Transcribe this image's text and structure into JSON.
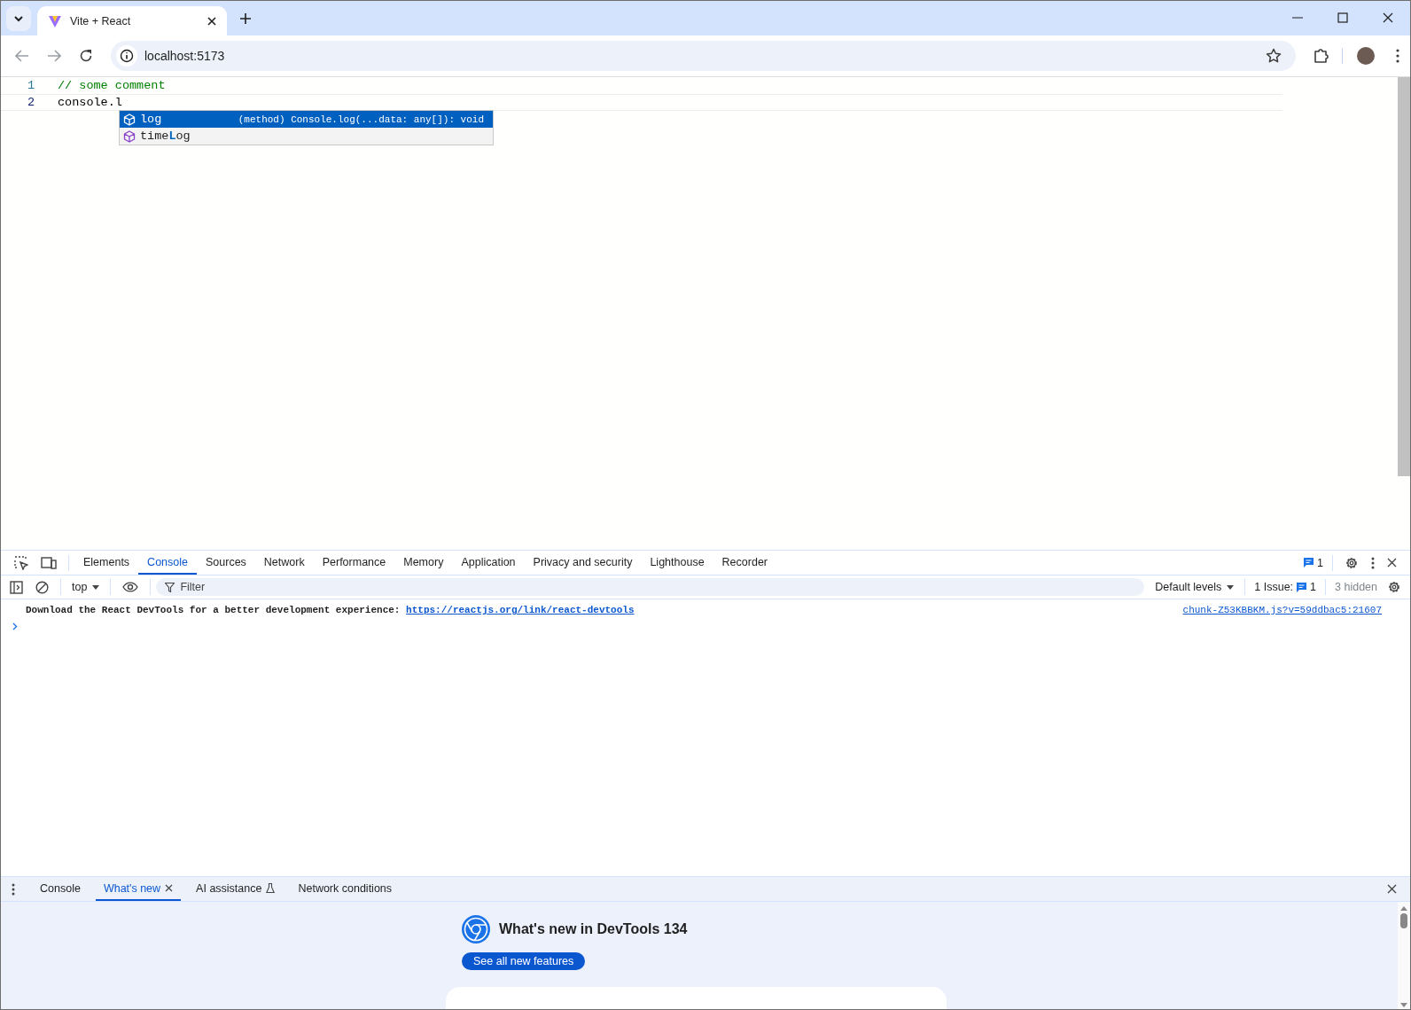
{
  "browser": {
    "tab": {
      "title": "Vite + React"
    },
    "address": "localhost:5173"
  },
  "editor": {
    "lines": [
      {
        "number": "1",
        "text": "// some comment",
        "kind": "comment",
        "current": false
      },
      {
        "number": "2",
        "text": "console.l",
        "kind": "code",
        "current": true
      }
    ],
    "suggestions": [
      {
        "parts": [
          {
            "text": "log",
            "match": false
          }
        ],
        "detail": "(method) Console.log(...data: any[]): void",
        "selected": true
      },
      {
        "parts": [
          {
            "text": "time",
            "match": false
          },
          {
            "text": "L",
            "match": true
          },
          {
            "text": "og",
            "match": false
          }
        ],
        "selected": false
      }
    ]
  },
  "devtools": {
    "tabs": [
      {
        "label": "Elements",
        "selected": false
      },
      {
        "label": "Console",
        "selected": true
      },
      {
        "label": "Sources",
        "selected": false
      },
      {
        "label": "Network",
        "selected": false
      },
      {
        "label": "Performance",
        "selected": false
      },
      {
        "label": "Memory",
        "selected": false
      },
      {
        "label": "Application",
        "selected": false
      },
      {
        "label": "Privacy and security",
        "selected": false
      },
      {
        "label": "Lighthouse",
        "selected": false
      },
      {
        "label": "Recorder",
        "selected": false
      }
    ],
    "issues_badge": "1",
    "console_toolbar": {
      "context": "top",
      "filter_placeholder": "Filter",
      "levels": "Default levels",
      "issues_label": "1 Issue:",
      "issues_count": "1",
      "hidden": "3 hidden"
    },
    "messages": [
      {
        "text": "Download the React DevTools for a better development experience: ",
        "link": "https://reactjs.org/link/react-devtools",
        "source": "chunk-Z53KBBKM.js?v=59ddbac5:21607"
      }
    ],
    "drawer": {
      "tabs": [
        {
          "label": "Console",
          "selected": false,
          "kind": "plain"
        },
        {
          "label": "What's new",
          "selected": true,
          "kind": "closable"
        },
        {
          "label": "AI assistance",
          "selected": false,
          "kind": "experimental"
        },
        {
          "label": "Network conditions",
          "selected": false,
          "kind": "plain"
        }
      ],
      "heading": "What's new in DevTools 134",
      "button": "See all new features"
    }
  }
}
